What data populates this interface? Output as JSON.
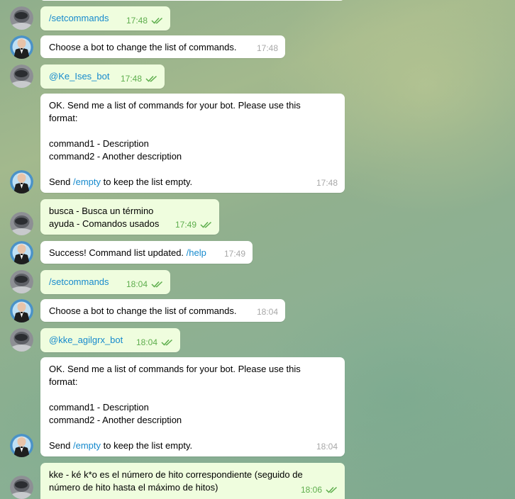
{
  "colors": {
    "outgoing_bubble": "#effdde",
    "incoming_bubble": "#ffffff",
    "link": "#168acd",
    "outgoing_time": "#5eae4d",
    "incoming_time": "#a8a8a8"
  },
  "messages": [
    {
      "dir": "out",
      "kind": "command",
      "text": "/setcommands",
      "time": "17:48",
      "read": true
    },
    {
      "dir": "in",
      "kind": "text",
      "text": "Choose a bot to change the list of commands.",
      "time": "17:48"
    },
    {
      "dir": "out",
      "kind": "command",
      "text": "@Ke_Ises_bot",
      "time": "17:48",
      "read": true
    },
    {
      "dir": "in",
      "kind": "format",
      "line1": "OK. Send me a list of commands for your bot. Please use this format:",
      "line2": "command1 - Description",
      "line3": "command2 - Another description",
      "send_prefix": "Send ",
      "send_cmd": "/empty",
      "send_suffix": " to keep the list empty.",
      "time": "17:48"
    },
    {
      "dir": "out",
      "kind": "text",
      "text": "busca - Busca un término\nayuda - Comandos usados",
      "time": "17:49",
      "read": true
    },
    {
      "dir": "in",
      "kind": "success",
      "text": "Success! Command list updated. ",
      "cmd": "/help",
      "time": "17:49"
    },
    {
      "dir": "out",
      "kind": "command",
      "text": "/setcommands",
      "time": "18:04",
      "read": true
    },
    {
      "dir": "in",
      "kind": "text",
      "text": "Choose a bot to change the list of commands.",
      "time": "18:04"
    },
    {
      "dir": "out",
      "kind": "command",
      "text": "@kke_agilgrx_bot",
      "time": "18:04",
      "read": true
    },
    {
      "dir": "in",
      "kind": "format",
      "line1": "OK. Send me a list of commands for your bot. Please use this format:",
      "line2": "command1 - Description",
      "line3": "command2 - Another description",
      "send_prefix": "Send ",
      "send_cmd": "/empty",
      "send_suffix": " to keep the list empty.",
      "time": "18:04"
    },
    {
      "dir": "out",
      "kind": "text",
      "text": "kke - ké k*o es el número de hito correspondiente (seguido de número de hito hasta el máximo de hitos)",
      "time": "18:06",
      "read": true
    }
  ]
}
